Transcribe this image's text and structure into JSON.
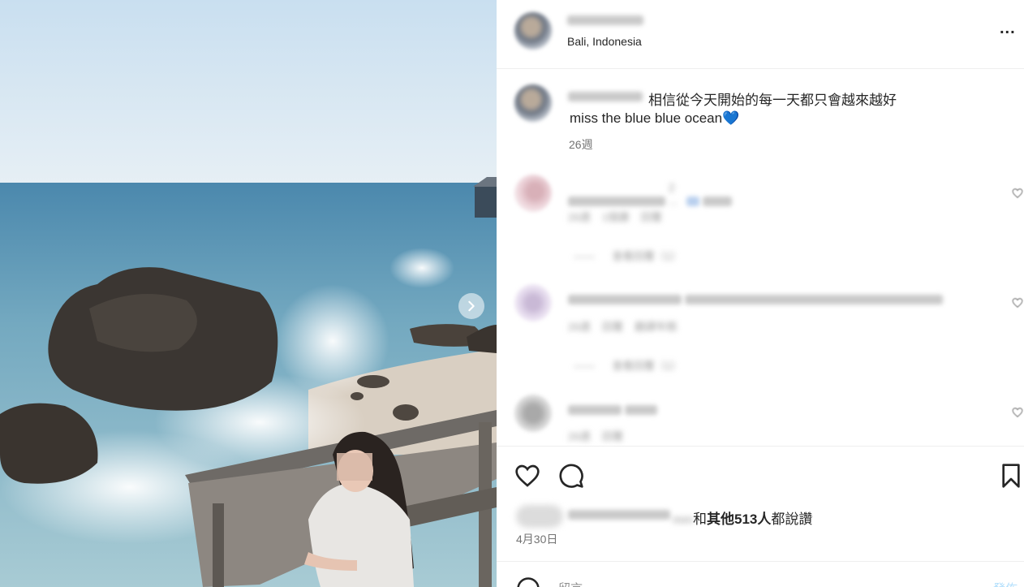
{
  "post": {
    "location": "Bali, Indonesia",
    "more_label": "...",
    "caption": {
      "line1": "相信從今天開始的每一天都只會越來越好",
      "line2": "miss the blue blue ocean💙",
      "time": "26週"
    }
  },
  "comments": [
    {
      "text": "2 ...",
      "time": "26週",
      "likes": "1個讚",
      "reply": "回覆",
      "view_replies": "查看回覆（1）"
    },
    {
      "time": "26週",
      "likes": "回覆",
      "reply": "翻譯年糕",
      "view_replies": "查看回覆（1）"
    },
    {
      "time": "26週",
      "reply": "回覆"
    }
  ],
  "likes": {
    "blurred_names": "mm",
    "text_prefix": "和",
    "count_text": "其他513人",
    "text_suffix": "都說讚"
  },
  "date": "4月30日",
  "comment_box": {
    "placeholder": "留言",
    "post_label": "發佈"
  },
  "icons": [
    "next-arrow-icon",
    "more-options-icon",
    "heart-icon",
    "comment-icon",
    "bookmark-icon",
    "emoji-icon"
  ],
  "colors": {
    "text": "#262626",
    "secondary": "#737373",
    "divider": "#efefef",
    "post_button": "#b2dffc"
  }
}
